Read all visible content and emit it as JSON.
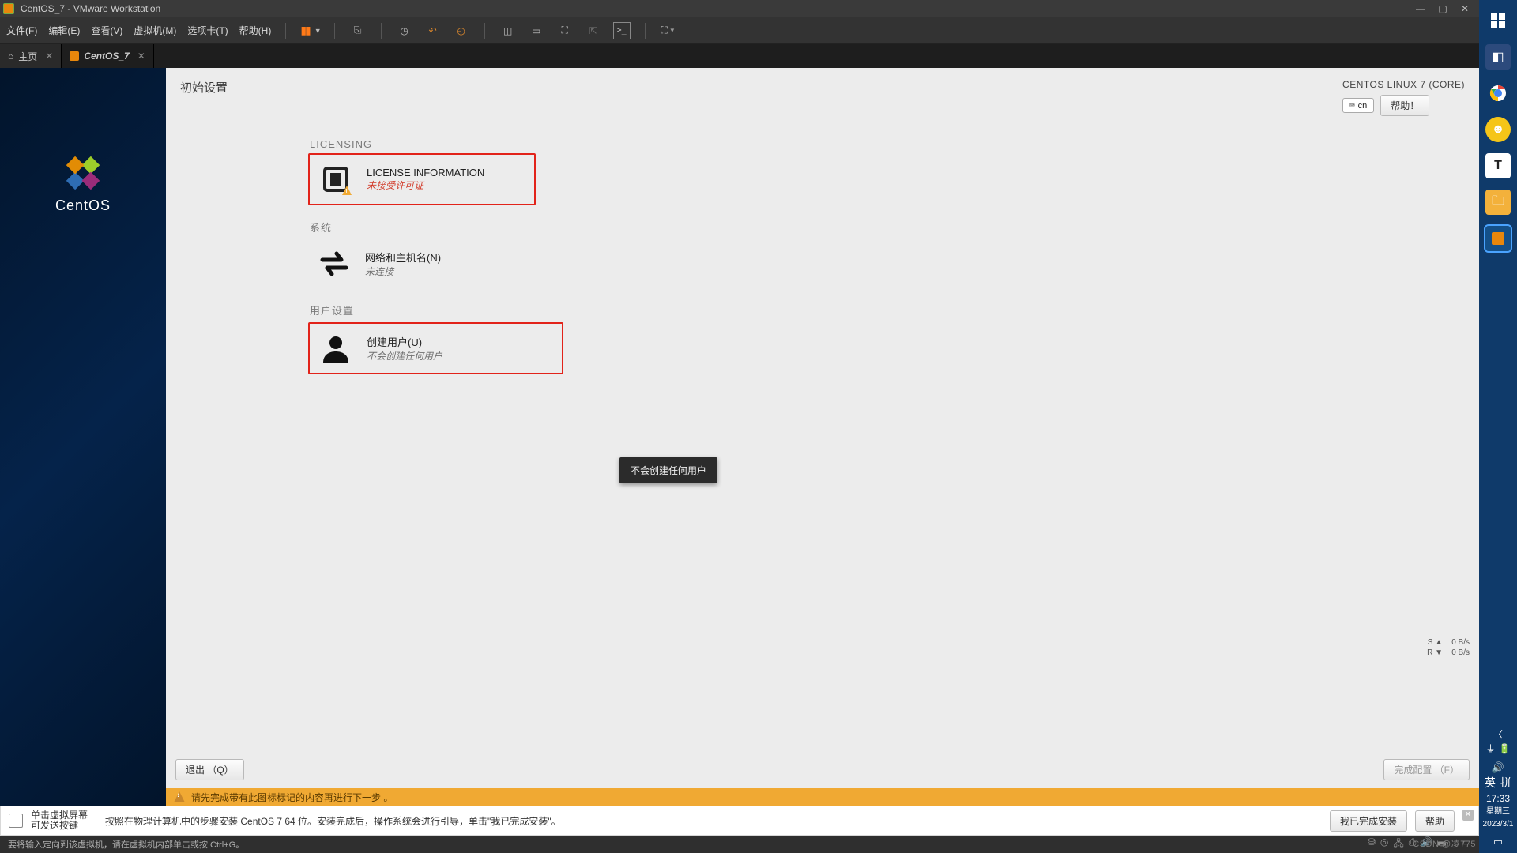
{
  "window": {
    "title": "CentOS_7 - VMware Workstation",
    "min": "—",
    "max": "▢",
    "close": "✕"
  },
  "menu": {
    "file": "文件(F)",
    "edit": "编辑(E)",
    "view": "查看(V)",
    "vm": "虚拟机(M)",
    "tabs_m": "选项卡(T)",
    "help": "帮助(H)"
  },
  "tabs": {
    "home": "主页",
    "vm": "CentOS_7"
  },
  "sidebar": {
    "brand": "CentOS"
  },
  "guest": {
    "title": "初始设置",
    "distro": "CENTOS LINUX 7 (CORE)",
    "kbd": "cn",
    "help": "帮助！",
    "sections": {
      "licensing": "LICENSING",
      "system": "系统",
      "user": "用户设置"
    },
    "license": {
      "title": "LICENSE INFORMATION",
      "sub": "未接受许可证"
    },
    "network": {
      "title": "网络和主机名(N)",
      "sub": "未连接"
    },
    "user": {
      "title": "创建用户(U)",
      "sub": "不会创建任何用户"
    },
    "tooltip_user": "不会创建任何用户",
    "net_stats": {
      "s": "S ▲",
      "r": "R ▼",
      "up": "0 B/s",
      "down": "0 B/s"
    },
    "quit": "退出 （Q）",
    "finish": "完成配置 （F）",
    "warn": "请先完成带有此图标标记的内容再进行下一步 。"
  },
  "hint": {
    "lead1": "单击虚拟屏幕",
    "lead2": "可发送按键",
    "body": "按照在物理计算机中的步骤安装 CentOS 7 64 位。安装完成后，操作系统会进行引导，单击\"我已完成安装\"。",
    "done": "我已完成安装",
    "help": "帮助"
  },
  "status": {
    "text": "要将输入定向到该虚拟机，请在虚拟机内部单击或按 Ctrl+G。"
  },
  "watermark": "CSDN @凌775",
  "win": {
    "time": "17:33",
    "dow": "星期三",
    "date": "2023/3/1",
    "ime1": "英",
    "ime2": "拼"
  }
}
